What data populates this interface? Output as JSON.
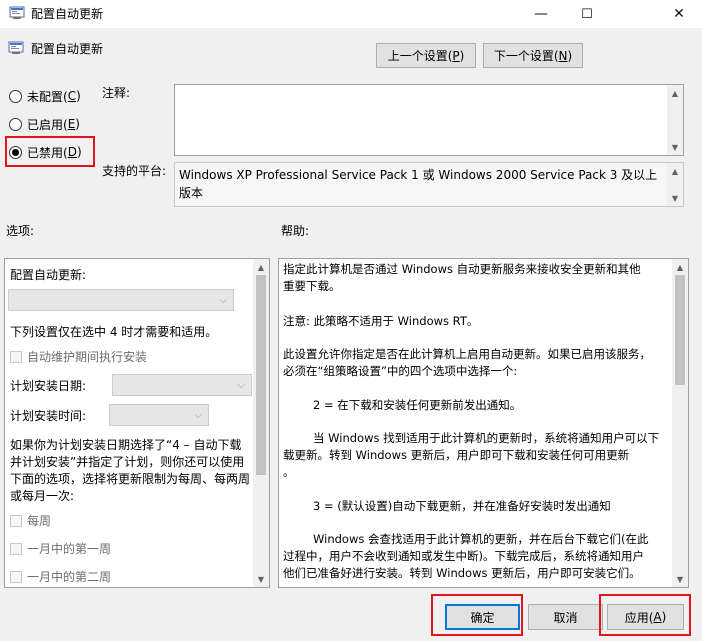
{
  "window": {
    "title": "配置自动更新",
    "minimize": "—",
    "maximize": "☐",
    "close": "✕"
  },
  "header": {
    "policy_name": "配置自动更新",
    "prev_label": "上一个设置(",
    "prev_key": "P",
    "prev_end": ")",
    "next_label": "下一个设置(",
    "next_key": "N",
    "next_end": ")"
  },
  "state": {
    "not_configured": "未配置(",
    "not_configured_key": "C",
    "enabled": "已启用(",
    "enabled_key": "E",
    "disabled": "已禁用(",
    "disabled_key": "D",
    "close_paren": ")",
    "selected": "disabled"
  },
  "comment_label": "注释:",
  "platform_label": "支持的平台:",
  "platform_value": "Windows XP Professional Service Pack 1 或 Windows 2000 Service Pack 3 及以上版本",
  "options": {
    "label": "选项:",
    "configure_label": "配置自动更新:",
    "note": "下列设置仅在选中 4 时才需要和适用。",
    "maintenance": "自动维护期间执行安装",
    "schedule_day": "计划安装日期:",
    "schedule_time": "计划安装时间:",
    "info_line1": "如果你为计划安装日期选择了“4 – 自动下载",
    "info_line2": "并计划安装”并指定了计划，则你还可以使用",
    "info_line3": "下面的选项，选择将更新限制为每周、每两周",
    "info_line4": "或每月一次:",
    "weekly": "每周",
    "first_week": "一月中的第一周",
    "second_week": "一月中的第二周"
  },
  "help": {
    "label": "帮助:",
    "p1_l1": "指定此计算机是否通过 Windows 自动更新服务来接收安全更新和其他",
    "p1_l2": "重要下载。",
    "p2": "注意: 此策略不适用于 Windows RT。",
    "p3_l1": "此设置允许你指定是否在此计算机上启用自动更新。如果已启用该服务，",
    "p3_l2": "必须在“组策略设置”中的四个选项中选择一个:",
    "p4": "2 = 在下载和安装任何更新前发出通知。",
    "p5_l1": "当 Windows 找到适用于此计算机的更新时，系统将通知用户可以下",
    "p5_l2": "载更新。转到 Windows 更新后，用户即可下载和安装任何可用更新",
    "p5_l3": "。",
    "p6": "3 = (默认设置)自动下载更新，并在准备好安装时发出通知",
    "p7_l1": "Windows 会查找适用于此计算机的更新，并在后台下载它们(在此",
    "p7_l2": "过程中，用户不会收到通知或发生中断)。下载完成后，系统将通知用户",
    "p7_l3": "他们已准备好进行安装。转到 Windows 更新后，用户即可安装它们。"
  },
  "footer": {
    "ok": "确定",
    "cancel": "取消",
    "apply": "应用(",
    "apply_key": "A",
    "apply_end": ")"
  },
  "colors": {
    "highlight_red": "#e0131f",
    "accent_blue": "#0078d7"
  }
}
